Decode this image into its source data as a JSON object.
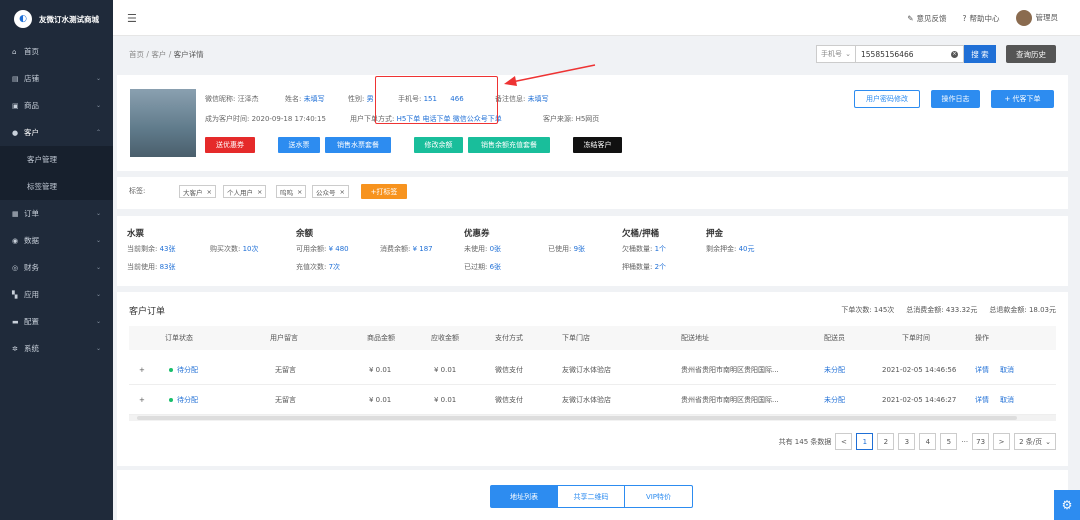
{
  "app": {
    "title": "友微订水测试商城",
    "logo_glyph": "◐"
  },
  "sidebar": {
    "items": [
      {
        "icon": "home-icon",
        "glyph": "⌂",
        "label": "首页",
        "chev": ""
      },
      {
        "icon": "store-icon",
        "glyph": "▤",
        "label": "店铺",
        "chev": "⌄"
      },
      {
        "icon": "goods-icon",
        "glyph": "▣",
        "label": "商品",
        "chev": "⌄"
      },
      {
        "icon": "customer-icon",
        "glyph": "●",
        "label": "客户",
        "chev": "⌃"
      },
      {
        "icon": "order-icon",
        "glyph": "▦",
        "label": "订单",
        "chev": "⌄"
      },
      {
        "icon": "data-icon",
        "glyph": "◉",
        "label": "数据",
        "chev": "⌄"
      },
      {
        "icon": "finance-icon",
        "glyph": "◎",
        "label": "财务",
        "chev": "⌄"
      },
      {
        "icon": "apps-icon",
        "glyph": "▚",
        "label": "应用",
        "chev": "⌄"
      },
      {
        "icon": "config-icon",
        "glyph": "▬",
        "label": "配置",
        "chev": "⌄"
      },
      {
        "icon": "system-icon",
        "glyph": "✲",
        "label": "系统",
        "chev": "⌄"
      }
    ],
    "subitems": [
      "客户管理",
      "标签管理"
    ]
  },
  "topbar": {
    "menu_glyph": "☰",
    "feedback": "意见反馈",
    "help": "帮助中心",
    "user": "管理员"
  },
  "breadcrumb": {
    "home": "首页",
    "sep": "/",
    "customer": "客户",
    "current": "客户详情"
  },
  "search": {
    "select": "手机号",
    "select_chev": "⌄",
    "value": "15585156466",
    "clear": "×",
    "button": "搜 索",
    "history": "查询历史"
  },
  "profile": {
    "nickname_label": "微信昵称:",
    "nickname": "汪泽杰",
    "name_label": "姓名:",
    "name": "未填写",
    "gender_label": "性别:",
    "gender": "男",
    "phone_label": "手机号:",
    "phone": "151      466",
    "remark_label": "备注信息:",
    "remark": "未填写",
    "since_label": "成为客户时间:",
    "since": "2020-09-18 17:40:15",
    "order_method_label": "用户下单方式:",
    "order_methods": "H5下单 电话下单 微信公众号下单",
    "source_label": "客户来源:",
    "source": "H5网页",
    "actions": [
      "送优惠券",
      "送水票",
      "销售水票套餐",
      "修改余额",
      "销售余额充值套餐",
      "冻结客户"
    ],
    "right_buttons": [
      "用户密码修改",
      "操作日志",
      "+ 代客下单"
    ]
  },
  "tags": {
    "label": "标签:",
    "items": [
      "大客户",
      "个人用户",
      "呜呜",
      "公众号"
    ],
    "remove": "×",
    "add": "+打标签"
  },
  "stats": {
    "ticket": {
      "title": "水票",
      "remain_label": "当前剩余:",
      "remain": "43张",
      "bought_label": "购买次数:",
      "bought": "10次",
      "used_label": "当前使用:",
      "used": "83张"
    },
    "balance": {
      "title": "余额",
      "avail_label": "可用余额:",
      "avail": "¥ 480",
      "spent_label": "消费余额:",
      "spent": "¥ 187",
      "recharge_label": "充值次数:",
      "recharge": "7次"
    },
    "coupon": {
      "title": "优惠券",
      "unused_label": "未使用:",
      "unused": "0张",
      "used_label": "已使用:",
      "used": "9张",
      "expired_label": "已过期:",
      "expired": "6张"
    },
    "owe": {
      "title": "欠桶/押桶",
      "owe_label": "欠桶数量:",
      "owe": "1个",
      "deposit_label": "押桶数量:",
      "deposit": "2个"
    },
    "deposit": {
      "title": "押金",
      "remain_label": "剩余押金:",
      "remain": "40元"
    }
  },
  "orders": {
    "title": "客户订单",
    "summary": [
      "下单次数: 145次",
      "总消费金额: 433.32元",
      "总退款金额: 18.03元"
    ],
    "headers": [
      "订单状态",
      "用户留言",
      "商品金额",
      "应收金额",
      "支付方式",
      "下单门店",
      "配送地址",
      "配送员",
      "下单时间",
      "操作"
    ],
    "rows": [
      {
        "status": "待分配",
        "msg": "无留言",
        "goods": "¥ 0.01",
        "due": "¥ 0.01",
        "pay": "微信支付",
        "store": "友微订水体验店",
        "addr": "贵州省贵阳市南明区贵阳国际...",
        "courier": "未分配",
        "time": "2021-02-05 14:46:56",
        "op1": "详情",
        "op2": "取消"
      },
      {
        "status": "待分配",
        "msg": "无留言",
        "goods": "¥ 0.01",
        "due": "¥ 0.01",
        "pay": "微信支付",
        "store": "友微订水体验店",
        "addr": "贵州省贵阳市南明区贵阳国际...",
        "courier": "未分配",
        "time": "2021-02-05 14:46:27",
        "op1": "详情",
        "op2": "取消"
      }
    ],
    "expand": "+",
    "pager": {
      "total": "共有 145 条数据",
      "prev": "<",
      "pages": [
        "1",
        "2",
        "3",
        "4",
        "5"
      ],
      "ellipsis": "···",
      "last": "73",
      "next": ">",
      "size": "2 条/页",
      "size_chev": "⌄"
    }
  },
  "bottom_tabs": [
    "地址列表",
    "共享二维码",
    "VIP特价"
  ],
  "colors": {
    "sidebar": "#1f2a3a",
    "primary": "#1f6fd6",
    "red": "#e52a2a",
    "teal": "#19be9b"
  }
}
